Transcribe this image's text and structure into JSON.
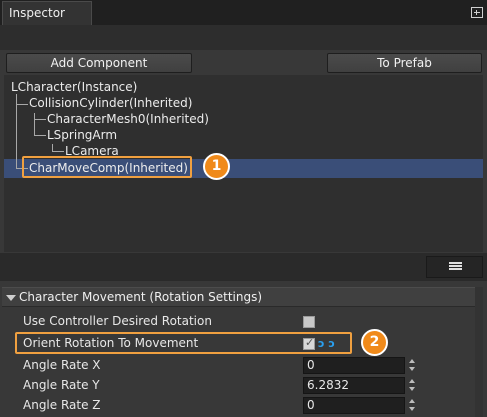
{
  "panel": {
    "tab_title": "Inspector",
    "pin_icon": "pin-icon"
  },
  "toolbar": {
    "add_component_label": "Add Component",
    "to_prefab_label": "To Prefab"
  },
  "tree": {
    "items": [
      {
        "label": "LCharacter(Instance)"
      },
      {
        "label": "CollisionCylinder(Inherited)"
      },
      {
        "label": "CharacterMesh0(Inherited)"
      },
      {
        "label": "LSpringArm"
      },
      {
        "label": "LCamera"
      },
      {
        "label": "CharMoveComp(Inherited)",
        "selected": true
      }
    ]
  },
  "annotations": {
    "badge_1": "1",
    "badge_2": "2",
    "accent_color": "#f08a1a"
  },
  "details": {
    "category_label": "Character Movement (Rotation Settings)",
    "properties": [
      {
        "label": "Use Controller Desired Rotation",
        "type": "checkbox",
        "checked": false
      },
      {
        "label": "Orient Rotation To Movement",
        "type": "checkbox",
        "checked": true,
        "reset_icon": "ↄ ↄ"
      },
      {
        "label": "Angle Rate X",
        "type": "number",
        "value": "0"
      },
      {
        "label": "Angle Rate Y",
        "type": "number",
        "value": "6.2832"
      },
      {
        "label": "Angle Rate Z",
        "type": "number",
        "value": "0"
      }
    ]
  },
  "colors": {
    "selection": "#3a4e78",
    "highlight_border": "#f0a040",
    "reset_icon": "#2aa0f0"
  }
}
